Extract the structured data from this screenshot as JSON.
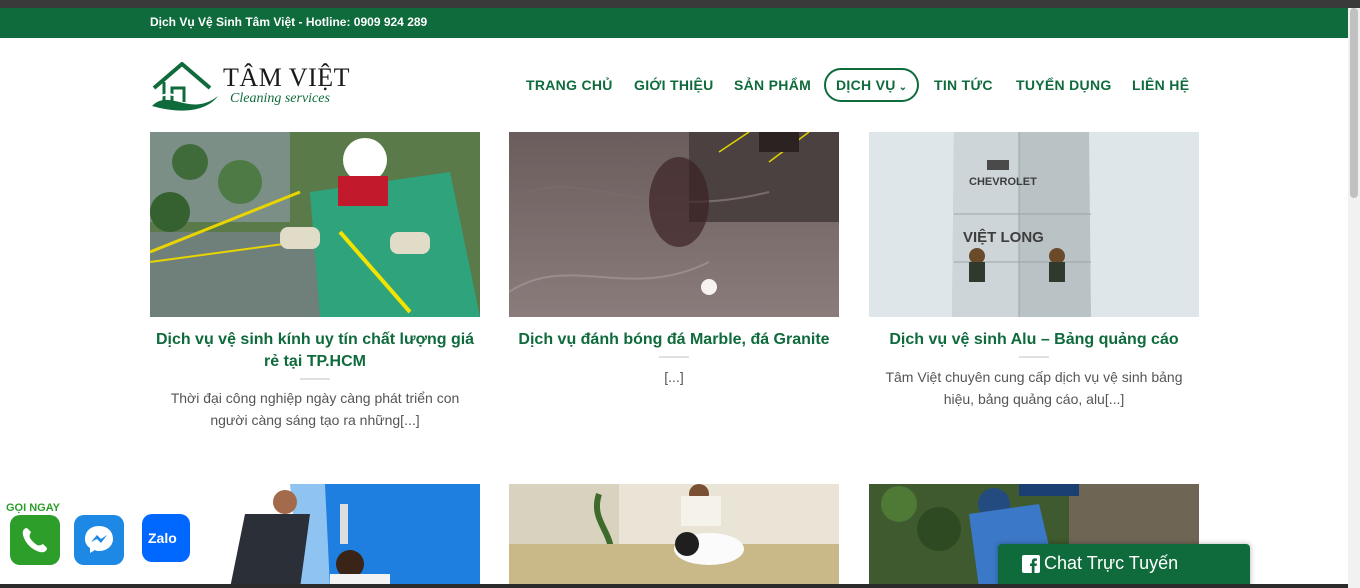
{
  "topbar": {
    "text": "Dịch Vụ Vệ Sinh Tâm Việt - Hotline: 0909 924 289"
  },
  "logo": {
    "title": "TÂM VIỆT",
    "subtitle": "Cleaning services"
  },
  "nav": [
    {
      "label": "TRANG CHỦ"
    },
    {
      "label": "GIỚI THIỆU"
    },
    {
      "label": "SẢN PHẨM"
    },
    {
      "label": "DỊCH VỤ",
      "active": true
    },
    {
      "label": "TIN TỨC"
    },
    {
      "label": "TUYỂN DỤNG"
    },
    {
      "label": "LIÊN HỆ"
    }
  ],
  "cards": [
    {
      "title": "Dịch vụ vệ sinh kính uy tín chất lượng giá rẻ tại TP.HCM",
      "excerpt": "Thời đại công nghiệp ngày càng phát triển con người càng sáng tạo ra những[...]"
    },
    {
      "title": "Dịch vụ đánh bóng đá Marble, đá Granite",
      "excerpt": "[...]"
    },
    {
      "title": "Dịch vụ vệ sinh Alu – Bảng quảng cáo",
      "excerpt": "Tâm Việt chuyên cung cấp dịch vụ vệ sinh bảng hiệu, bảng quảng cáo, alu[...]",
      "sign_text_top": "CHEVROLET",
      "sign_text_main": "VIỆT LONG"
    }
  ],
  "social": {
    "call_label": "GỌI NGAY",
    "zalo_label": "Zalo",
    "icons": [
      "phone-icon",
      "messenger-icon",
      "zalo-icon"
    ]
  },
  "chat": {
    "label": "Chat Trực Tuyến",
    "icon": "facebook-square-icon"
  },
  "colors": {
    "brand_green": "#0f6b3c",
    "call_green": "#2e9e2a",
    "messenger_blue": "#1e88e5",
    "zalo_blue": "#0068ff"
  }
}
